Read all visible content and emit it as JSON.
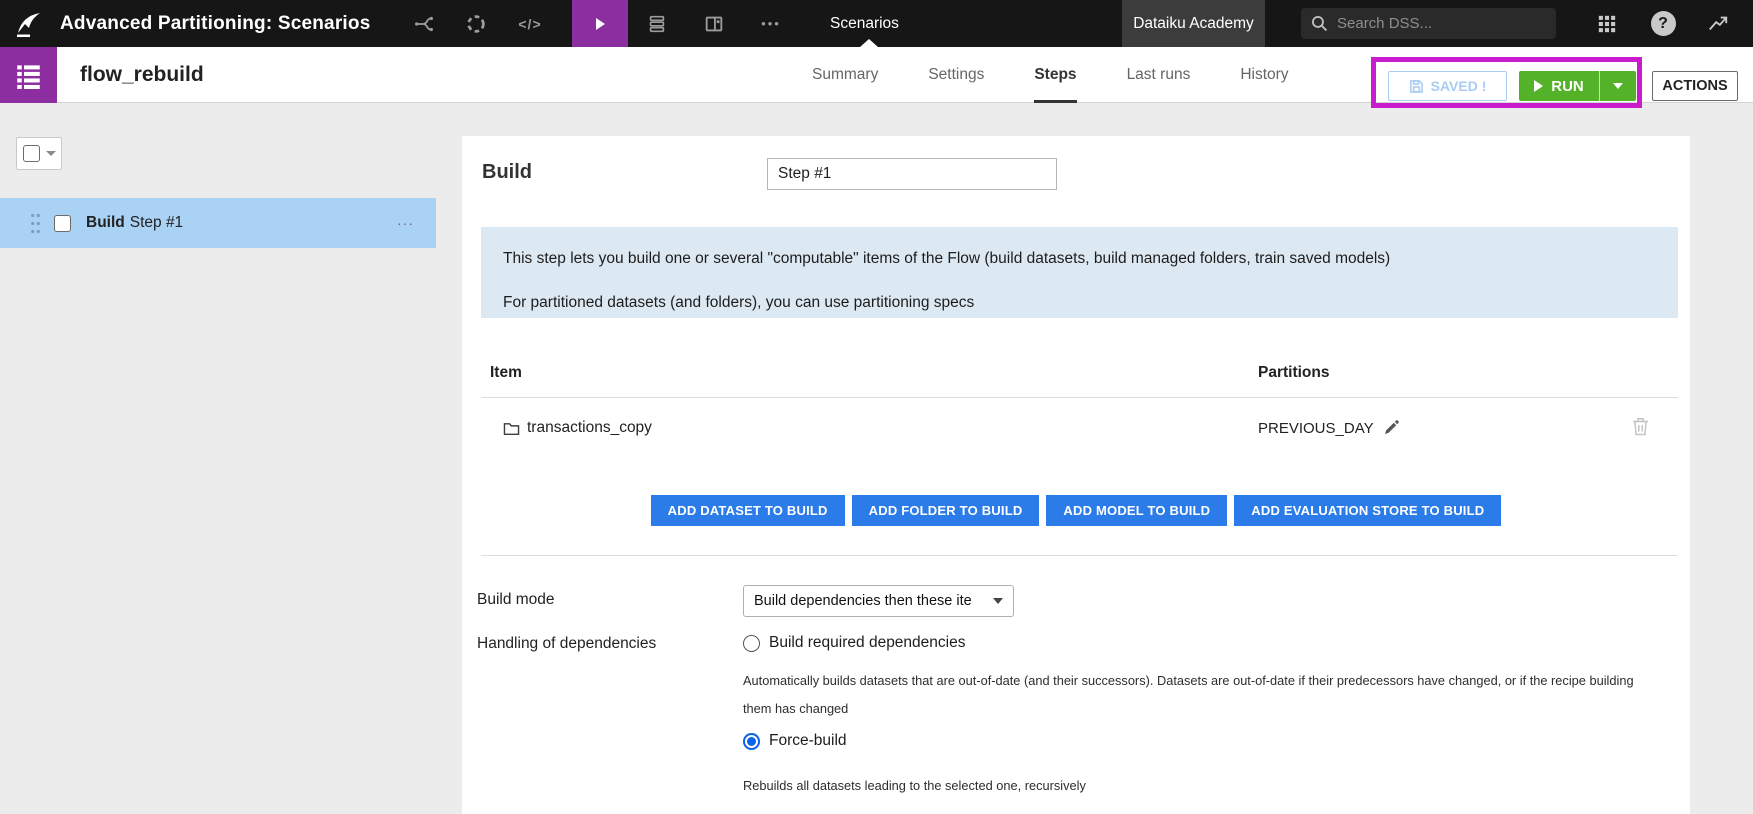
{
  "colors": {
    "navbar_bg": "#161616",
    "brand_purple": "#8c2da0",
    "run_green": "#54b229",
    "annotation_magenta": "#c81ccd",
    "add_button_blue": "#2b7ce9",
    "selected_step_bg": "#a9d2f4",
    "info_box_bg": "#dde9f2",
    "radio_selected_blue": "#0e62e8",
    "saved_blue": "#a9cdf2"
  },
  "navbar": {
    "project_title": "Advanced Partitioning: Scenarios",
    "section_label": "Scenarios",
    "academy_label": "Dataiku Academy",
    "search_placeholder": "Search DSS...",
    "more_glyph": "•••",
    "code_glyph": "</>",
    "help_glyph": "?"
  },
  "header": {
    "scenario_name": "flow_rebuild",
    "tabs": [
      {
        "label": "Summary"
      },
      {
        "label": "Settings"
      },
      {
        "label": "Steps",
        "active": true
      },
      {
        "label": "Last runs"
      },
      {
        "label": "History"
      }
    ],
    "saved_label": "SAVED !",
    "run_label": "RUN",
    "actions_label": "ACTIONS"
  },
  "sidebar": {
    "step": {
      "type_label": "Build",
      "name": "Step #1",
      "more_glyph": "···"
    }
  },
  "main": {
    "step_type_title": "Build",
    "step_name": {
      "value": "Step #1"
    },
    "info_lines": [
      "This step lets you build one or several \"computable\" items of the Flow (build datasets, build managed folders, train saved models)",
      "For partitioned datasets (and folders), you can use partitioning specs"
    ],
    "items_table": {
      "columns": [
        "Item",
        "Partitions"
      ],
      "rows": [
        {
          "item": "transactions_copy",
          "partitions": "PREVIOUS_DAY"
        }
      ]
    },
    "add_buttons": [
      "ADD DATASET TO BUILD",
      "ADD FOLDER TO BUILD",
      "ADD MODEL TO BUILD",
      "ADD EVALUATION STORE TO BUILD"
    ],
    "build_mode": {
      "label": "Build mode",
      "value": "Build dependencies then these ite"
    },
    "dependencies": {
      "label": "Handling of dependencies",
      "options": [
        {
          "label": "Build required dependencies",
          "selected": false,
          "help": "Automatically builds datasets that are out-of-date (and their successors). Datasets are out-of-date if their predecessors have changed, or if the recipe building them has changed"
        },
        {
          "label": "Force-build",
          "selected": true,
          "help": "Rebuilds all datasets leading to the selected one, recursively"
        }
      ]
    }
  }
}
